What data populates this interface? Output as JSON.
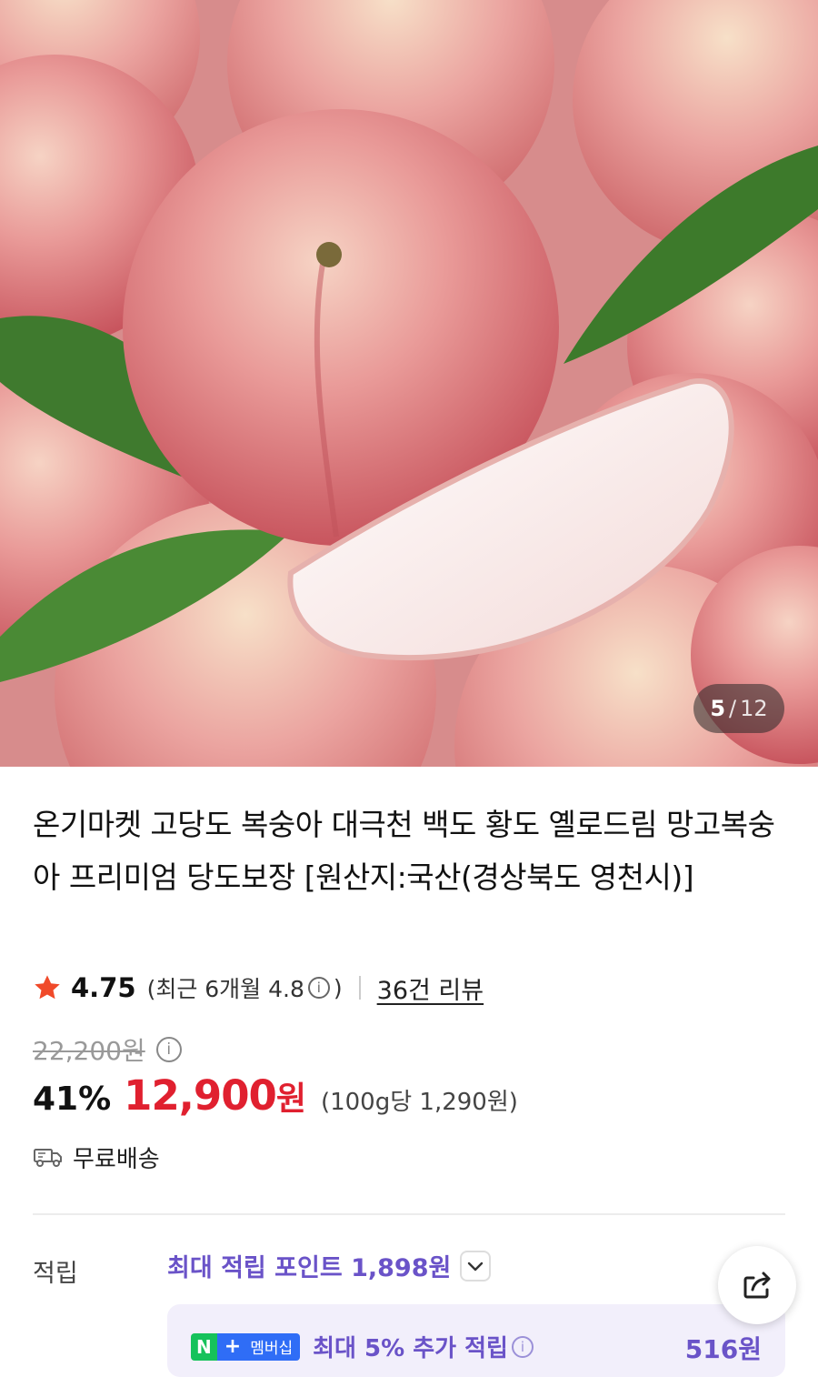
{
  "gallery": {
    "current": "5",
    "separator": "/",
    "total": "12"
  },
  "product": {
    "title": "온기마켓 고당도 복숭아 대극천 백도 황도 옐로드림 망고복숭아 프리미엄 당도보장 [원산지:국산(경상북도 영천시)]"
  },
  "rating": {
    "score": "4.75",
    "recent_prefix": "(최근 6개월 4.8",
    "recent_suffix": ")",
    "reviews_label": "36건 리뷰"
  },
  "price": {
    "original": "22,200원",
    "discount": "41%",
    "sale": "12,900",
    "currency": "원",
    "unit_price": "(100g당 1,290원)"
  },
  "shipping": {
    "label": "무료배송"
  },
  "points": {
    "label": "적립",
    "max_points": "최대 적립 포인트 1,898원",
    "membership_badge_n": "N",
    "membership_badge_plus": "+",
    "membership_badge_text": "멤버십",
    "membership_text": "최대 5% 추가 적립",
    "membership_amount": "516원"
  },
  "colors": {
    "accent_purple": "#6a53c8",
    "price_red": "#e0202f",
    "star": "#f04a2a"
  },
  "icons": [
    "star-icon",
    "info-icon",
    "truck-icon",
    "chevron-down-icon",
    "share-icon"
  ]
}
